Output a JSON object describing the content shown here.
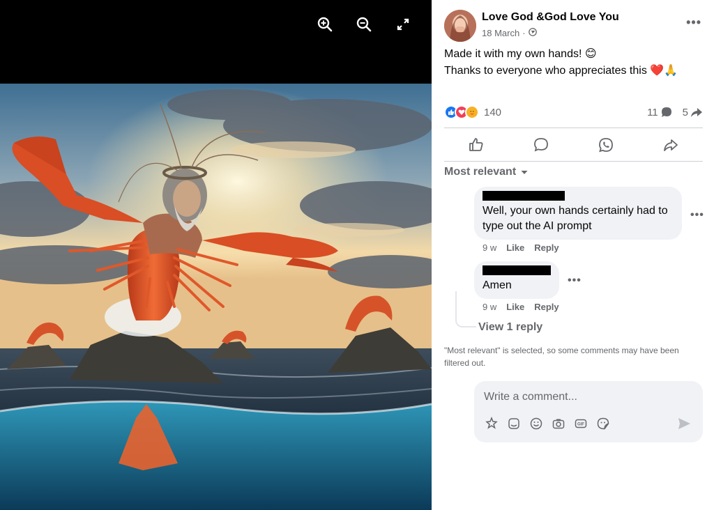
{
  "viewer": {
    "tools": [
      "zoom-in-icon",
      "zoom-out-icon",
      "expand-icon"
    ],
    "image_alt": "AI-generated image of a bearded man with a crown of thorns whose body is a giant shrimp, rising from the sea at sunset with shrimp on rocks around"
  },
  "post": {
    "author": "Love God &God Love You",
    "date": "18 March",
    "date_separator": "·",
    "privacy_icon": "globe-icon",
    "text_line1": "Made it with my own hands! 😊",
    "text_line2": "Thanks to everyone who appreciates this ❤️🙏",
    "reactions": {
      "icons": [
        "like",
        "love",
        "care"
      ],
      "count": "140"
    },
    "comments_count": "11",
    "shares_count": "5"
  },
  "actions": [
    "like-icon",
    "comment-icon",
    "whatsapp-icon",
    "share-icon"
  ],
  "sort_label": "Most relevant",
  "comments": [
    {
      "text": "Well, your own hands certainly had to type out the AI prompt",
      "time": "9 w",
      "like": "Like",
      "reply": "Reply"
    },
    {
      "text": "Amen",
      "time": "9 w",
      "like": "Like",
      "reply": "Reply"
    }
  ],
  "view_replies": "View 1 reply",
  "notice": "\"Most relevant\" is selected, so some comments may have been filtered out.",
  "composer": {
    "placeholder": "Write a comment...",
    "icons": [
      "avatar-sticker-icon",
      "sticker-icon",
      "emoji-icon",
      "camera-icon",
      "gif-icon",
      "sticker-face-icon"
    ]
  },
  "colors": {
    "accent": "#1877f2",
    "secondary_text": "#65676b",
    "bubble": "#f0f2f5"
  }
}
